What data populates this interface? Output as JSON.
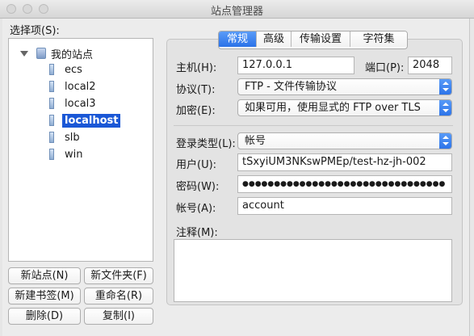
{
  "window": {
    "title": "站点管理器"
  },
  "left": {
    "label": "选择项(S):",
    "root": "我的站点",
    "sites": [
      "ecs",
      "local2",
      "local3",
      "localhost",
      "slb",
      "win"
    ],
    "selected_index": 3,
    "buttons": {
      "new_site": "新站点(N)",
      "new_folder": "新文件夹(F)",
      "new_bookmark": "新建书签(M)",
      "rename": "重命名(R)",
      "delete": "删除(D)",
      "copy": "复制(I)"
    }
  },
  "tabs": [
    "常规",
    "高级",
    "传输设置",
    "字符集"
  ],
  "form": {
    "host_label": "主机(H):",
    "host_value": "127.0.0.1",
    "port_label": "端口(P):",
    "port_value": "2048",
    "protocol_label": "协议(T):",
    "protocol_value": "FTP - 文件传输协议",
    "encryption_label": "加密(E):",
    "encryption_value": "如果可用，使用显式的 FTP over TLS",
    "logon_label": "登录类型(L):",
    "logon_value": "帐号",
    "user_label": "用户(U):",
    "user_value": "tSxyiUM3NKswPMEp/test-hz-jh-002",
    "password_label": "密码(W):",
    "password_value": "●●●●●●●●●●●●●●●●●●●●●●●●●●●●●●●●",
    "account_label": "帐号(A):",
    "account_value": "account",
    "comments_label": "注释(M):"
  },
  "colors": {
    "accent": "#2b72e8",
    "selection": "#1a57d6"
  }
}
